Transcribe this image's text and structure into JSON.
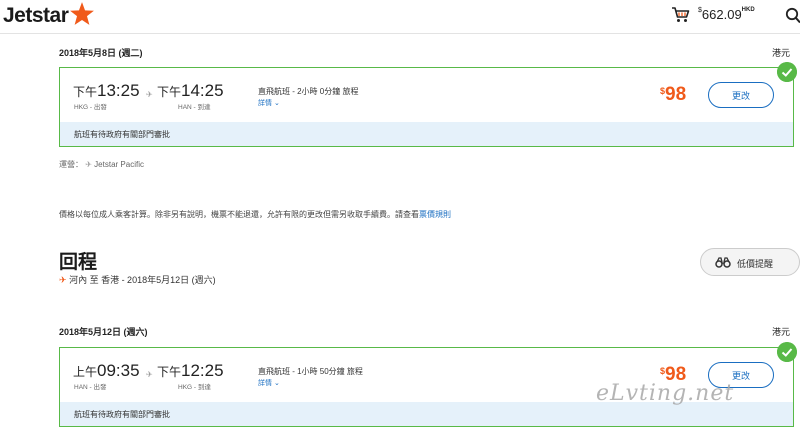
{
  "header": {
    "logo_text": "Jetstar",
    "cart_currency_symbol": "$",
    "cart_amount": "662.09",
    "cart_currency_unit": "HKD"
  },
  "outbound": {
    "date": "2018年5月8日 (週二)",
    "currency": "港元",
    "depart_ampm": "下午",
    "depart_time": "13:25",
    "depart_sub": "HKG - 出發",
    "arrive_ampm": "下午",
    "arrive_time": "14:25",
    "arrive_sub": "HAN - 到達",
    "flight_info": "直飛航班 - 2小時 0分鐘 旅程",
    "details_label": "詳情",
    "price_symbol": "$",
    "price": "98",
    "change_label": "更改",
    "note": "航班有待政府有關部門審批",
    "operated_label": "運營：",
    "operated_by": "Jetstar Pacific"
  },
  "disclaimer": {
    "text": "價格以每位成人乘客計算。除非另有說明，機票不能退還，允許有限的更改但需另收取手續費。請查看",
    "link": "票價規則"
  },
  "return": {
    "title": "回程",
    "route": "河內 至 香港 - 2018年5月12日 (週六)",
    "alert_label": "低價提醒",
    "date": "2018年5月12日 (週六)",
    "currency": "港元",
    "depart_ampm": "上午",
    "depart_time": "09:35",
    "depart_sub": "HAN - 出發",
    "arrive_ampm": "下午",
    "arrive_time": "12:25",
    "arrive_sub": "HKG - 到達",
    "flight_info": "直飛航班 - 1小時 50分鐘 旅程",
    "details_label": "詳情",
    "price_symbol": "$",
    "price": "98",
    "change_label": "更改",
    "note": "航班有待政府有關部門審批"
  },
  "watermark": "eLvting.net",
  "colors": {
    "brand_orange": "#f05a1a",
    "selected_green": "#58b947",
    "link_blue": "#1a6ec1",
    "note_bg": "#e5f1fa"
  }
}
